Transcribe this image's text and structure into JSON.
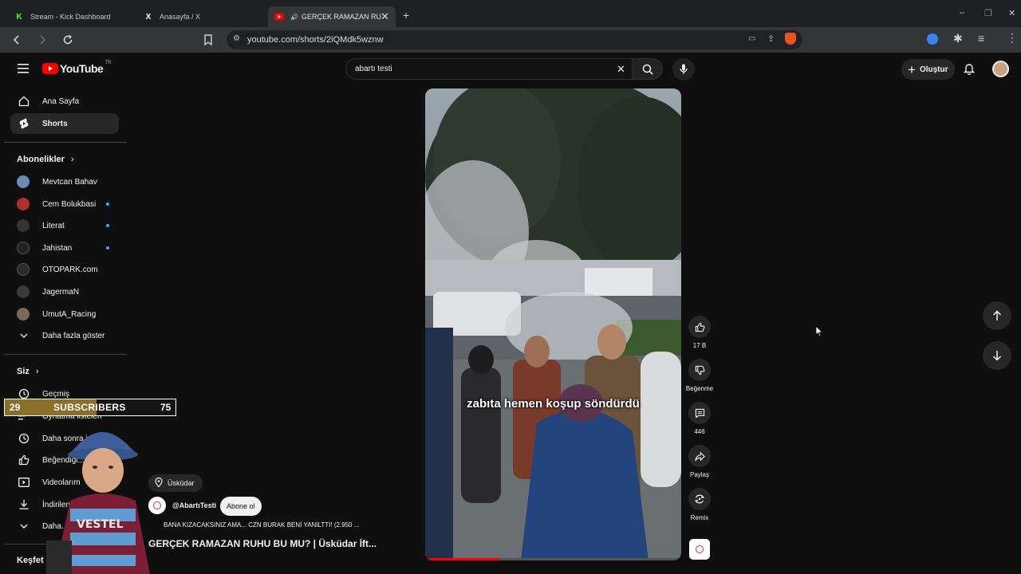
{
  "browser": {
    "tabs": [
      {
        "title": "Stream - Kick Dashboard",
        "favicon": "K"
      },
      {
        "title": "Anasayfa / X",
        "favicon": "X"
      },
      {
        "title": "GERÇEK RAMAZAN RUHU",
        "favicon": "yt"
      }
    ],
    "new_tab": "+",
    "url": "youtube.com/shorts/2iQMdk5wznw",
    "window": {
      "minimize": "–",
      "restore": "❐",
      "close": "✕"
    }
  },
  "youtube": {
    "logo": "YouTube",
    "logo_country": "TR",
    "search_value": "abartı testi",
    "create_label": "Oluştur",
    "sidebar": {
      "home": "Ana Sayfa",
      "shorts": "Shorts",
      "subs_title": "Abonelikler",
      "subscriptions": [
        {
          "name": "Mevtcan Bahav",
          "color": "#6a8caf",
          "dot": false
        },
        {
          "name": "Cem Bolukbasi",
          "color": "#b03030",
          "dot": true
        },
        {
          "name": "Literat",
          "color": "#333333",
          "dot": true
        },
        {
          "name": "Jahistan",
          "color": "#222222",
          "dot": true
        },
        {
          "name": "OTOPARK.com",
          "color": "#2b2b2b",
          "dot": false
        },
        {
          "name": "JagermaN",
          "color": "#3a3a3a",
          "dot": false
        },
        {
          "name": "UmutA_Racing",
          "color": "#7a6a5a",
          "dot": false
        }
      ],
      "show_more": "Daha fazla göster",
      "you_title": "Siz",
      "you_items": [
        "Geçmiş",
        "Oynatma listeleri",
        "Daha sonra izle",
        "Beğendiği...",
        "Videolarım",
        "İndirilenler",
        "Daha..."
      ],
      "explore_title": "Keşfet"
    },
    "short": {
      "caption": "zabıta hemen koşup söndürdü",
      "location": "Üsküdar",
      "channel": "@AbartıTesti",
      "subscribe": "Abone ol",
      "linked_video": "BANA KIZACAKSINIZ AMA... CZN BURAK BENİ YANILTTI! (2.950 ...",
      "title": "GERÇEK RAMAZAN RUHU BU MU? | Üsküdar İft..."
    },
    "actions": {
      "likes": "17 B",
      "dislike": "Beğenme",
      "comments": "446",
      "share": "Paylaş",
      "remix": "Remix"
    }
  },
  "overlay": {
    "left_count": "29",
    "label": "SUBSCRIBERS",
    "right_count": "75"
  }
}
